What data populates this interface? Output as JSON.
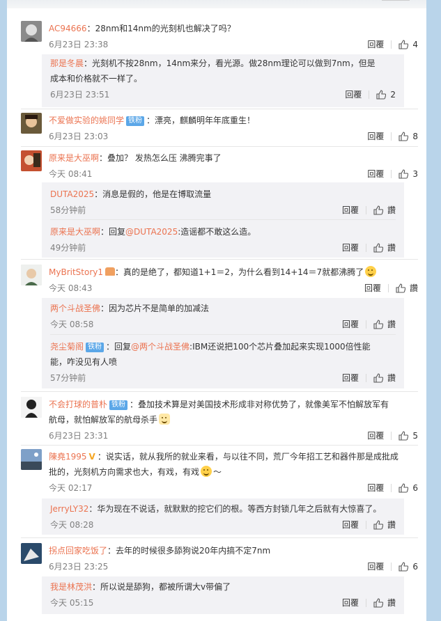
{
  "labels": {
    "reply": "回覆",
    "like_text": "讚"
  },
  "comments": [
    {
      "user": "AC94666",
      "text": "：28nm和14nm的光刻机也解决了吗？",
      "time": "6月23日 23:38",
      "likes": "4",
      "replies": [
        {
          "user": "那是冬晨",
          "text": "：光刻机不按28nm，14nm来分，看光源。做28nm理论可以做到7nm，但是成本和价格就不一样了。",
          "time": "6月23日 23:51",
          "likes": "2"
        }
      ]
    },
    {
      "user": "不爱做实验的姚同学",
      "badge": "铁粉",
      "text": "：漂亮，麒麟明年年底重生！",
      "time": "6月23日 23:03",
      "likes": "8"
    },
    {
      "user": "原来是大巫啊",
      "text": "：叠加？ 发热怎么压  沸腾完事了",
      "time": "今天 08:41",
      "likes": "3",
      "replies": [
        {
          "user": "DUTA2025",
          "text": "：消息是假的，他是在博取流量",
          "time": "58分钟前"
        },
        {
          "user": "原来是大巫啊",
          "text_pre": "：回复",
          "mention": "@DUTA2025",
          "text": ":造谣都不敢这么造。",
          "time": "49分钟前"
        }
      ]
    },
    {
      "user": "MyBritStory1",
      "text": "：真的是绝了，都知道1+1＝2，为什么看到14+14＝7就都沸腾了",
      "time": "今天 08:43",
      "replies": [
        {
          "user": "两个斗战圣佛",
          "text": "：因为芯片不是简单的加减法",
          "time": "今天 08:58"
        },
        {
          "user": "尧尘菊阁",
          "badge": "铁粉",
          "text_pre": "：回复",
          "mention": "@两个斗战圣佛",
          "text": ":IBM还说把100个芯片叠加起来实现1000倍性能能，咋没见有人喷",
          "time": "57分钟前"
        }
      ]
    },
    {
      "user": "不会打球的普朴",
      "badge": "铁粉",
      "text": "：叠加技术算是对美国技术形成非对称优势了，就像美军不怕解放军有航母，就怕解放军的航母杀手",
      "time": "6月23日 23:31",
      "likes": "5"
    },
    {
      "user": "陳堯1995",
      "vbadge": "V",
      "text": "：说实话，就从我所的就业来看，与以往不同，荒厂今年招工艺和器件那是成批成批的，光刻机方向需求也大，有戏，有戏",
      "text_post": "～",
      "time": "今天 02:17",
      "likes": "6",
      "replies": [
        {
          "user": "JerryLY32",
          "text": "：华为现在不说话，就默默的挖它们的根。等西方封锁几年之后就有大惊喜了。",
          "time": "今天 08:28"
        }
      ]
    },
    {
      "user": "拐点回家吃饭了",
      "text": "：去年的时候很多舔狗说20年内搞不定7nm",
      "time": "6月23日 23:25",
      "likes": "6",
      "replies": [
        {
          "user": "我是林茂洪",
          "text": "：所以说是舔狗，都被所谓大v带偏了",
          "time": "今天 05:15"
        }
      ]
    }
  ]
}
